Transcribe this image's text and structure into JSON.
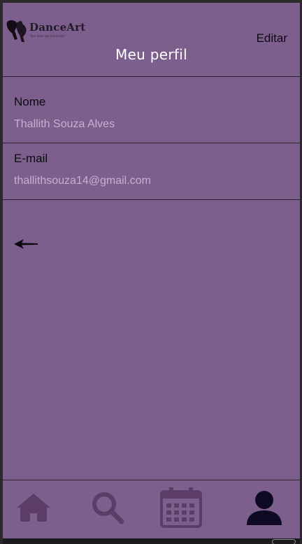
{
  "header": {
    "logo_text": "DanceArt",
    "logo_tagline": "Your learn get Enhanced",
    "edit_label": "Editar",
    "title": "Meu perfil"
  },
  "profile": {
    "name_label": "Nome",
    "name_value": "Thallith Souza Alves",
    "email_label": "E-mail",
    "email_value": "thallithsouza14@gmail.com"
  },
  "nav": {
    "items": [
      {
        "icon": "home-icon",
        "active": false
      },
      {
        "icon": "search-icon",
        "active": false
      },
      {
        "icon": "calendar-icon",
        "active": false
      },
      {
        "icon": "user-icon",
        "active": true
      }
    ],
    "active_color": "#0e0a24",
    "inactive_color": "#5b3d68"
  },
  "colors": {
    "background": "#7d5f8e",
    "value_text": "#c4b1d0",
    "title_text": "#ffffff"
  }
}
